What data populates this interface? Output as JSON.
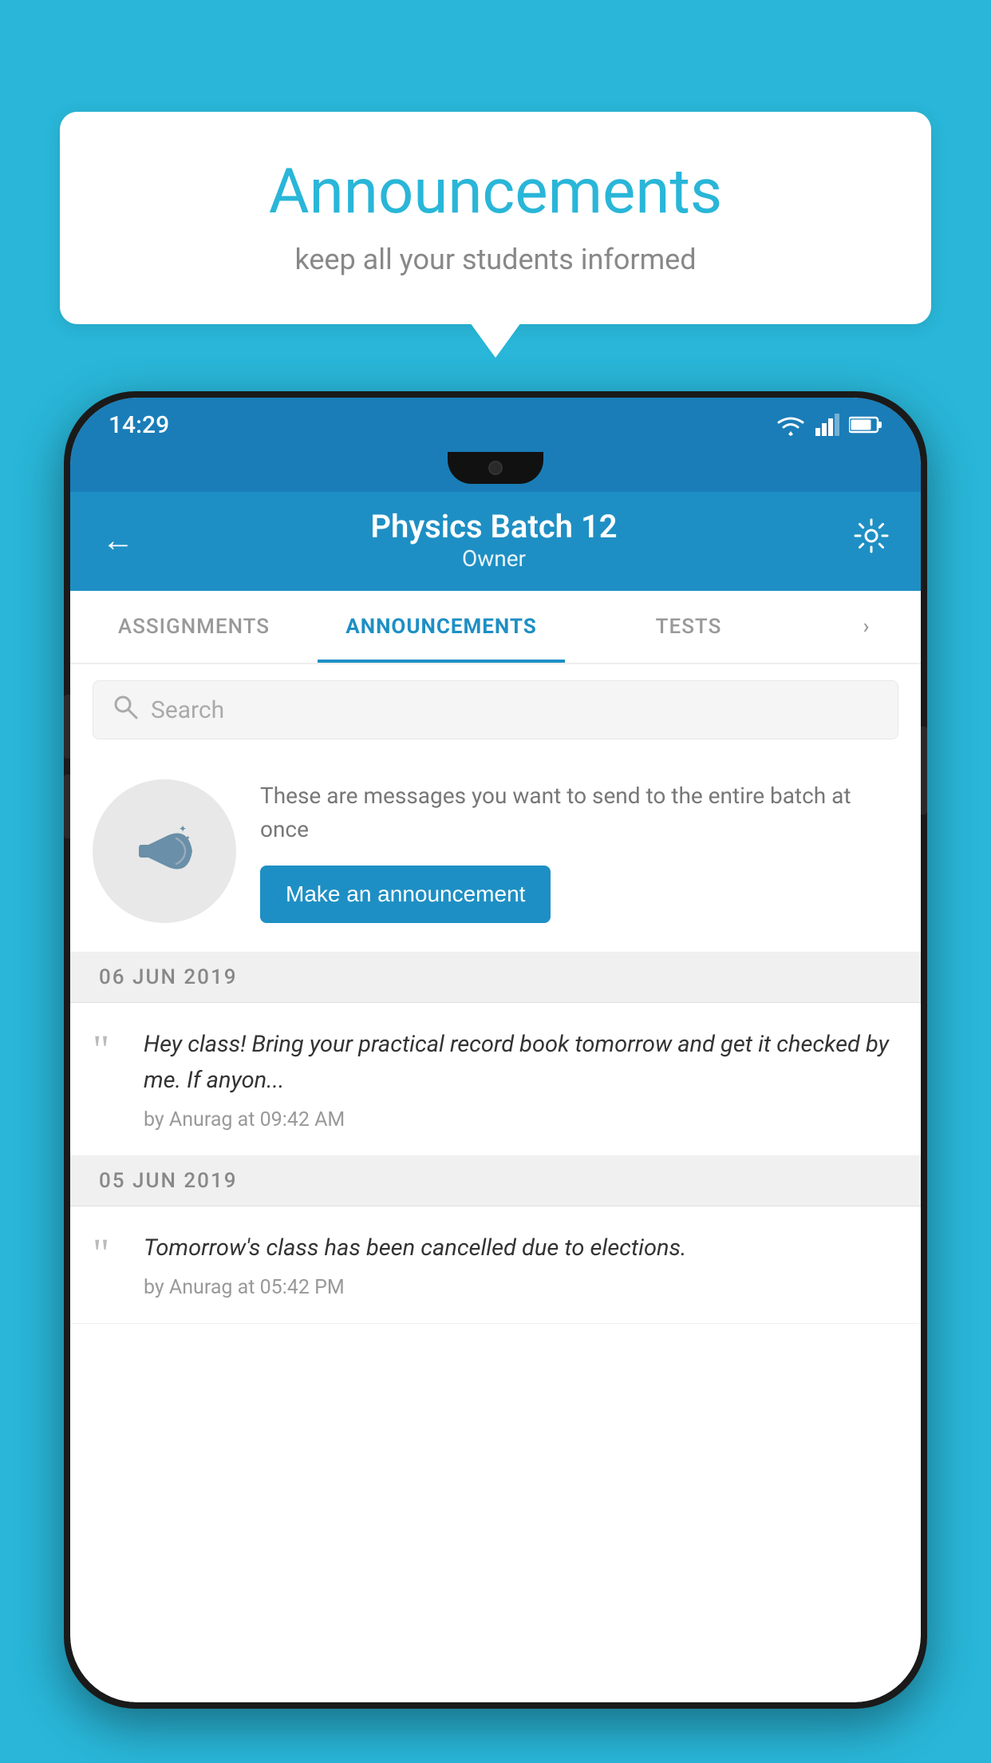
{
  "background_color": "#29b6d8",
  "speech_bubble": {
    "title": "Announcements",
    "subtitle": "keep all your students informed"
  },
  "phone": {
    "status_bar": {
      "time": "14:29"
    },
    "header": {
      "title": "Physics Batch 12",
      "subtitle": "Owner",
      "back_label": "←"
    },
    "tabs": [
      {
        "label": "ASSIGNMENTS",
        "active": false
      },
      {
        "label": "ANNOUNCEMENTS",
        "active": true
      },
      {
        "label": "TESTS",
        "active": false
      },
      {
        "label": "...",
        "active": false
      }
    ],
    "search": {
      "placeholder": "Search"
    },
    "promo": {
      "description": "These are messages you want to send to the entire batch at once",
      "button_label": "Make an announcement"
    },
    "announcements": [
      {
        "date": "06  JUN  2019",
        "text": "Hey class! Bring your practical record book tomorrow and get it checked by me. If anyon...",
        "meta": "by Anurag at 09:42 AM"
      },
      {
        "date": "05  JUN  2019",
        "text": "Tomorrow's class has been cancelled due to elections.",
        "meta": "by Anurag at 05:42 PM"
      }
    ]
  }
}
